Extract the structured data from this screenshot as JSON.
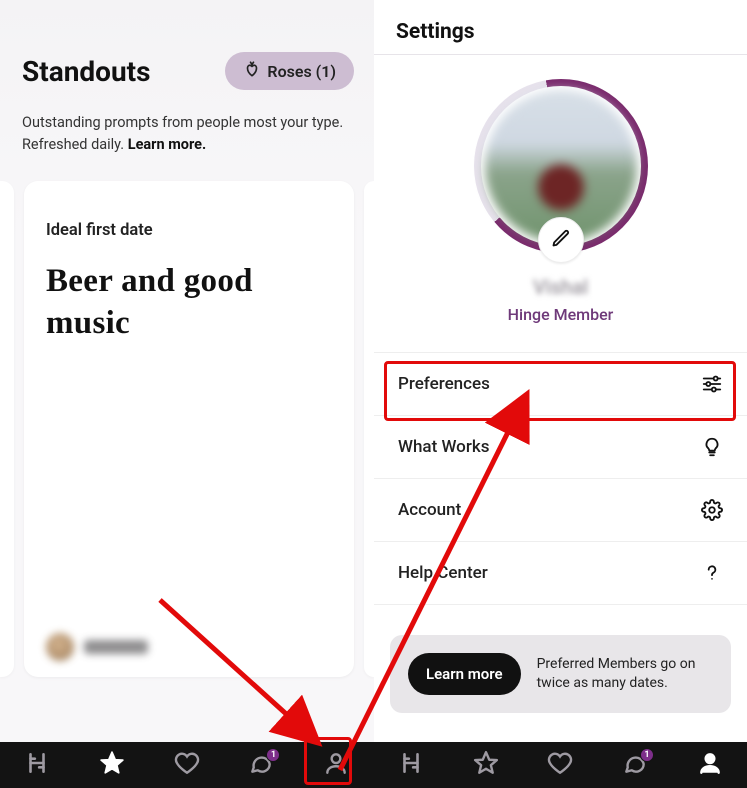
{
  "left": {
    "title": "Standouts",
    "roses_label": "Roses (1)",
    "subhead_text": "Outstanding prompts from people most your type. Refreshed daily. ",
    "learn_more": "Learn more.",
    "card": {
      "prompt": "Ideal first date",
      "answer": "Beer and good music",
      "username": "Jashtran"
    }
  },
  "right": {
    "header": "Settings",
    "profile_name": "Vishal",
    "member_label": "Hinge Member",
    "rows": [
      {
        "label": "Preferences",
        "icon": "sliders-icon"
      },
      {
        "label": "What Works",
        "icon": "lightbulb-icon"
      },
      {
        "label": "Account",
        "icon": "gear-icon"
      },
      {
        "label": "Help Center",
        "icon": "question-icon"
      }
    ],
    "promo": {
      "button": "Learn more",
      "text": "Preferred Members go on twice as many dates."
    }
  },
  "nav": {
    "badge": "1",
    "tabs": [
      "hinge-icon",
      "star-icon",
      "heart-icon",
      "chat-icon",
      "person-icon"
    ]
  }
}
